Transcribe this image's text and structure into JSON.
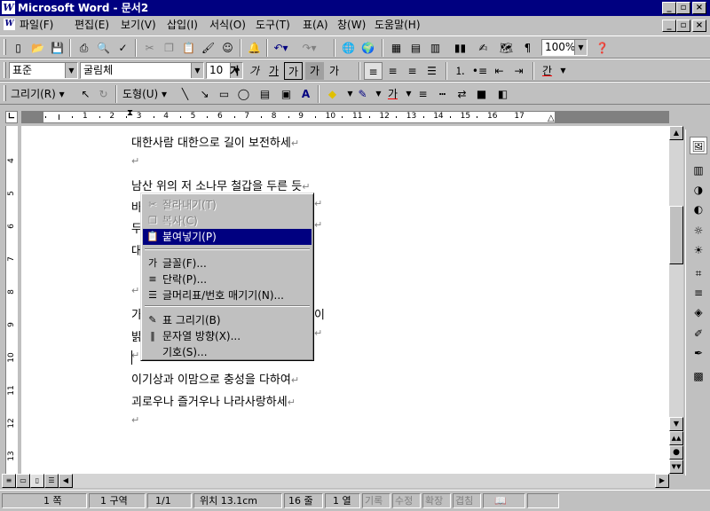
{
  "window": {
    "title": "Microsoft Word - 문서2",
    "app_icon": "W",
    "controls": [
      "_",
      "▫",
      "×"
    ]
  },
  "menu": [
    "파일(F)",
    "편집(E)",
    "보기(V)",
    "삽입(I)",
    "서식(O)",
    "도구(T)",
    "표(A)",
    "창(W)",
    "도움말(H)"
  ],
  "standard_toolbar": {
    "zoom": "100%"
  },
  "format_toolbar": {
    "style": "표준",
    "font": "굴림체",
    "size": "10",
    "buttons": [
      "가",
      "가",
      "가",
      "가",
      "가",
      "가"
    ],
    "font_color_label": "간"
  },
  "drawing_toolbar": {
    "draw_label": "그리기(R)",
    "autoshape_label": "도형(U)"
  },
  "ruler": {
    "numbers": [
      "1",
      "2",
      "3",
      "4",
      "5",
      "6",
      "7",
      "8",
      "9",
      "10",
      "11",
      "12",
      "13",
      "14",
      "15",
      "16",
      "17"
    ],
    "vnumbers": [
      "4",
      "5",
      "6",
      "7",
      "8",
      "9",
      "10",
      "11",
      "12",
      "13"
    ]
  },
  "document": {
    "lines": [
      {
        "text": "대한사람 대한으로 길이 보전하세",
        "mark": "↵"
      },
      {
        "text": "",
        "mark": "↵"
      },
      {
        "text": "남산 위의 저 소나무 철갑을 두른 듯",
        "mark": "↵"
      },
      {
        "text": "바",
        "mark": ""
      },
      {
        "text": "두",
        "mark": ""
      },
      {
        "text": "대",
        "mark": ""
      },
      {
        "text": "",
        "mark": ""
      },
      {
        "text": "",
        "mark": "↵"
      },
      {
        "text": "가",
        "mark": ""
      },
      {
        "text": "밝",
        "mark": ""
      },
      {
        "text": "",
        "mark": "↵"
      },
      {
        "text": "이기상과 이맘으로 충성을 다하여",
        "mark": "↵"
      },
      {
        "text": "괴로우나 즐거우나 나라사랑하세",
        "mark": "↵"
      },
      {
        "text": "",
        "mark": "↵"
      }
    ],
    "partial_marks": {
      "row3": "↵",
      "row4": "↵",
      "row8": "이",
      "row9": "↵"
    }
  },
  "context_menu": {
    "items": [
      {
        "label": "잘라내기(T)",
        "icon": "✂",
        "state": "disabled"
      },
      {
        "label": "복사(C)",
        "icon": "❐",
        "state": "disabled"
      },
      {
        "label": "붙여넣기(P)",
        "icon": "📋",
        "state": "selected"
      },
      {
        "label": "글꼴(F)...",
        "icon": "가",
        "state": "normal"
      },
      {
        "label": "단락(P)...",
        "icon": "≡",
        "state": "normal"
      },
      {
        "label": "글머리표/번호 매기기(N)...",
        "icon": "☰",
        "state": "normal"
      },
      {
        "label": "표 그리기(B)",
        "icon": "✎",
        "state": "normal"
      },
      {
        "label": "문자열 방향(X)...",
        "icon": "‖",
        "state": "normal"
      },
      {
        "label": "기호(S)...",
        "icon": "",
        "state": "normal"
      }
    ]
  },
  "status": {
    "page": "1 쪽",
    "section": "1 구역",
    "pages": "1/1",
    "position": "위치 13.1cm",
    "line": "16 줄",
    "col": "1 열",
    "rec": "기록",
    "trk": "수정",
    "ext": "확장",
    "ovr": "겹침"
  },
  "colors": {
    "title_bg": "#000080",
    "chrome": "#c0c0c0",
    "selection": "#000080"
  }
}
